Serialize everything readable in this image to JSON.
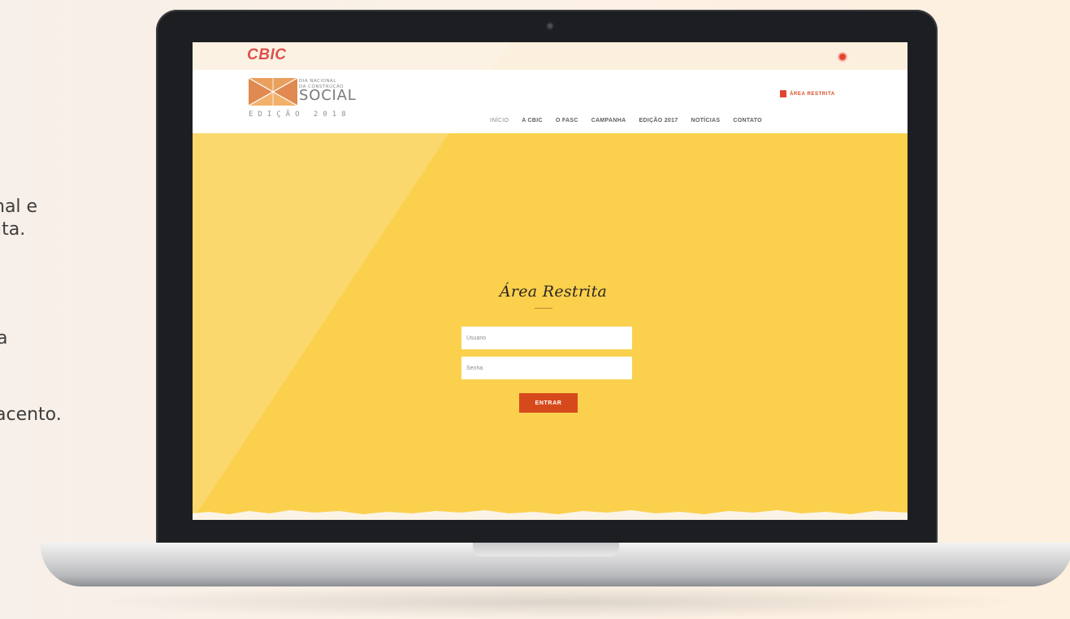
{
  "side_text": {
    "line1": "nal e",
    "line2": "ita.",
    "line3": "a",
    "line4": "acento."
  },
  "site": {
    "brand": "CBIC",
    "logo": {
      "line1": "DIA NACIONAL",
      "line2": "DA CONSTRUÇÃO",
      "main": "SOCIAL",
      "edition": "EDIÇÃO 2018"
    },
    "restricted_link": "ÁREA RESTRITA",
    "nav": [
      "INÍCIO",
      "A CBIC",
      "O FASC",
      "CAMPANHA",
      "EDIÇÃO 2017",
      "NOTÍCIAS",
      "CONTATO"
    ]
  },
  "login": {
    "title": "Área Restrita",
    "username_placeholder": "Usuário",
    "password_placeholder": "Senha",
    "submit_label": "ENTRAR"
  },
  "colors": {
    "background_yellow": "#fbd04d",
    "accent_orange": "#d6491d",
    "brand_red": "#d62b27"
  }
}
